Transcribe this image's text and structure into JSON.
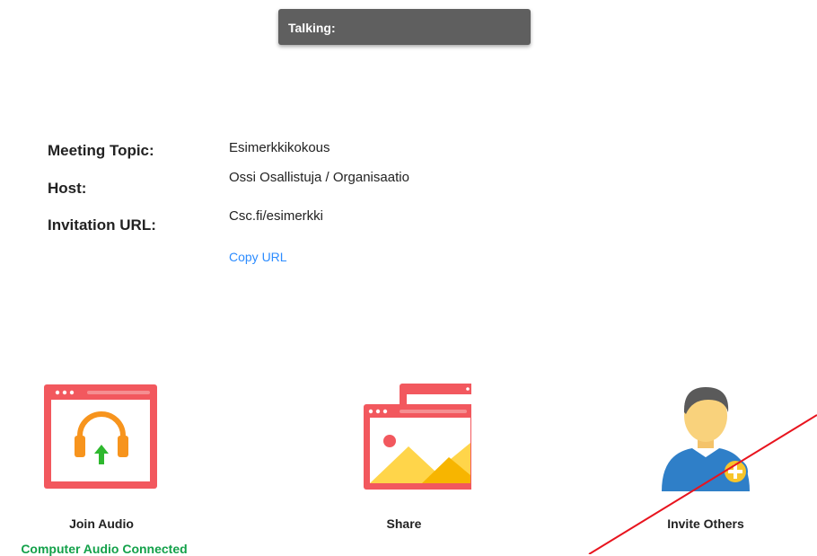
{
  "talking_bar": {
    "label": "Talking:"
  },
  "meeting_info": {
    "topic_label": "Meeting Topic:",
    "topic_value": "Esimerkkikokous",
    "host_label": "Host:",
    "host_value": "Ossi Osallistuja / Organisaatio",
    "url_label": "Invitation URL:",
    "url_value": "Csc.fi/esimerkki",
    "copy_url": "Copy URL"
  },
  "actions": {
    "join_audio": "Join Audio",
    "audio_status": "Computer Audio Connected",
    "share": "Share",
    "invite": "Invite Others"
  },
  "icons": {
    "join_audio": "headphones-window-icon",
    "share": "share-screen-icon",
    "invite": "invite-user-icon"
  },
  "colors": {
    "window_red": "#f2585e",
    "headphone_orange": "#f7941d",
    "arrow_green": "#2eb82e",
    "status_green": "#13a14a",
    "link_blue": "#2d8cff",
    "talking_bar_bg": "#5f5f5f",
    "annotation_red": "#e8141e"
  }
}
